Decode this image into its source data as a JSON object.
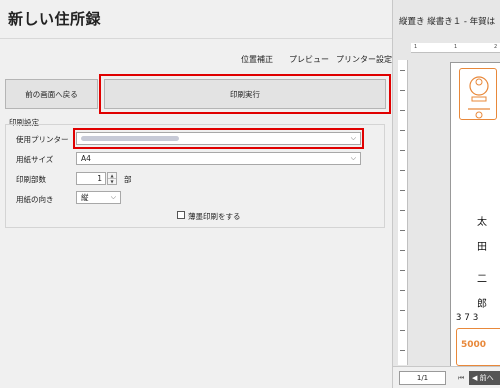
{
  "app": {
    "title": "新しい住所録"
  },
  "menu": {
    "position_adjust": "位置補正",
    "preview": "プレビュー",
    "printer_settings": "プリンター設定"
  },
  "buttons": {
    "back": "前の画面へ戻る",
    "print_execute": "印刷実行"
  },
  "print_settings": {
    "group_label": "印刷設定",
    "printer_label": "使用プリンター",
    "printer_value": "",
    "paper_size_label": "用紙サイズ",
    "paper_size_value": "A4",
    "copies_label": "印刷部数",
    "copies_value": "1",
    "copies_unit": "部",
    "orientation_label": "用紙の向き",
    "orientation_value": "縦",
    "thin_print_label": "薄墨印刷をする",
    "thin_print_checked": false
  },
  "preview": {
    "title": "縦置き 縦書き１ - 年賀は",
    "ruler_marks": [
      "1",
      "1",
      "2"
    ],
    "address_chars": [
      "太",
      "田",
      "二",
      "郎"
    ],
    "postal_code_partial": "373",
    "stamp_value": "5000",
    "page_indicator": "1/1",
    "prev_button": "前へ"
  },
  "colors": {
    "highlight": "#e00000",
    "stamp": "#e8883a"
  }
}
